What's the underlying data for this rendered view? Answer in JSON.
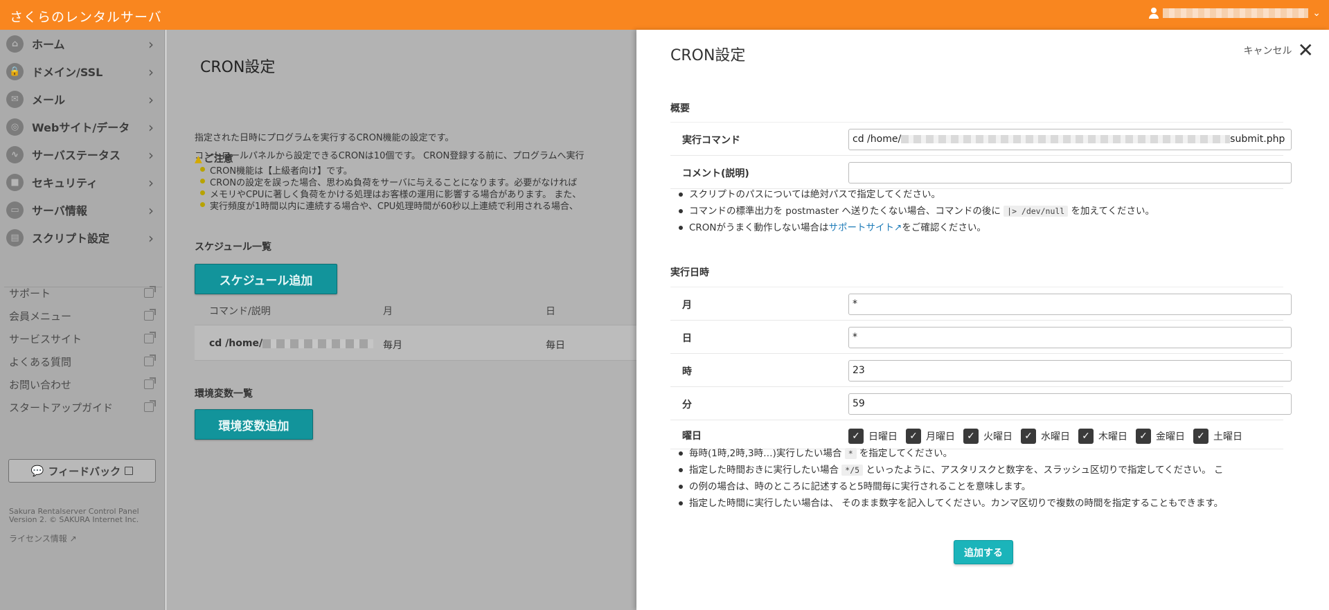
{
  "header": {
    "brand": "さくらのレンタルサーバ",
    "chevron": "⌄"
  },
  "sidebar": {
    "items": [
      {
        "label": "ホーム",
        "icon": "home-icon",
        "glyph": "⌂",
        "arrow": "›"
      },
      {
        "label": "ドメイン/SSL",
        "icon": "lock-domain-icon",
        "glyph": "🔒",
        "arrow": "›"
      },
      {
        "label": "メール",
        "icon": "mail-icon",
        "glyph": "✉",
        "arrow": "›"
      },
      {
        "label": "Webサイト/データ",
        "icon": "globe-icon",
        "glyph": "◎",
        "arrow": "›"
      },
      {
        "label": "サーバステータス",
        "icon": "chart-icon",
        "glyph": "∿",
        "arrow": "›"
      },
      {
        "label": "セキュリティ",
        "icon": "lock-icon",
        "glyph": "■",
        "arrow": "›"
      },
      {
        "label": "サーバ情報",
        "icon": "server-icon",
        "glyph": "▭",
        "arrow": "›"
      },
      {
        "label": "スクリプト設定",
        "icon": "file-icon",
        "glyph": "▤",
        "arrow": "›"
      }
    ],
    "links": [
      "サポート",
      "会員メニュー",
      "サービスサイト",
      "よくある質問",
      "お問い合わせ",
      "スタートアップガイド"
    ],
    "feedback": "フィードバック",
    "feedback_icon": "💬",
    "copyright_1": "Sakura Rentalserver Control Panel",
    "copyright_2": "Version 2. © SAKURA Internet Inc.",
    "license": "ライセンス情報"
  },
  "main": {
    "title": "CRON設定",
    "desc1": "指定された日時にプログラムを実行するCRON機能の設定です。",
    "desc2": "コントロールパネルから設定できるCRONは10個です。 CRON登録する前に、プログラムへ実行",
    "note_icon": "▲",
    "note_title": "ご注意",
    "notes": [
      "CRON機能は【上級者向け】です。",
      "CRONの設定を誤った場合、思わぬ負荷をサーバに与えることになります。必要がなければ",
      "メモリやCPUに著しく負荷をかける処理はお客様の運用に影響する場合があります。 また、",
      "実行頻度が1時間以内に連続する場合や、CPU処理時間が60秒以上連続で利用される場合、"
    ],
    "schedule_label": "スケジュール一覧",
    "add_schedule": "スケジュール追加",
    "columns": [
      "コマンド/説明",
      "月",
      "日"
    ],
    "row_cmd": "cd /home/",
    "row_month": "毎月",
    "row_day": "毎日",
    "env_label": "環境変数一覧",
    "add_env": "環境変数追加"
  },
  "panel": {
    "title": "CRON設定",
    "cancel": "キャンセル",
    "close": "✕",
    "overview": "概要",
    "command_label": "実行コマンド",
    "command_prefix": "cd /home/",
    "command_suffix": "submit.php",
    "comment_label": "コメント(説明)",
    "comment_value": "",
    "hint1": "スクリプトのパスについては絶対パスで指定してください。",
    "hint2a": "コマンドの標準出力を postmaster へ送りたくない場合、コマンドの後に ",
    "hint2code": "|> /dev/null",
    "hint2b": " を加えてください。",
    "hint3a": "CRONがうまく動作しない場合は",
    "hint3link": "サポートサイト",
    "hint3ext": "↗",
    "hint3b": "をご確認ください。",
    "schedule": "実行日時",
    "month_label": "月",
    "month_value": "*",
    "day_label": "日",
    "day_value": "*",
    "hour_label": "時",
    "hour_value": "23",
    "minute_label": "分",
    "minute_value": "59",
    "weekday_label": "曜日",
    "weekdays": [
      "日曜日",
      "月曜日",
      "火曜日",
      "水曜日",
      "木曜日",
      "金曜日",
      "土曜日"
    ],
    "check": "✓",
    "time_hint1a": "毎時(1時,2時,3時…)実行したい場合 ",
    "time_hint1code": "*",
    "time_hint1b": " を指定してください。",
    "time_hint2a": "指定した時間おきに実行したい場合 ",
    "time_hint2code": "*/5",
    "time_hint2b": " といったように、アスタリスクと数字を、スラッシュ区切りで指定してください。 こ",
    "time_hint2c": "の例の場合は、時のところに記述すると5時間毎に実行されることを意味します。",
    "time_hint3": "指定した時間に実行したい場合は、 そのまま数字を記入してください。カンマ区切りで複数の時間を指定することもできます。",
    "submit": "追加する"
  }
}
